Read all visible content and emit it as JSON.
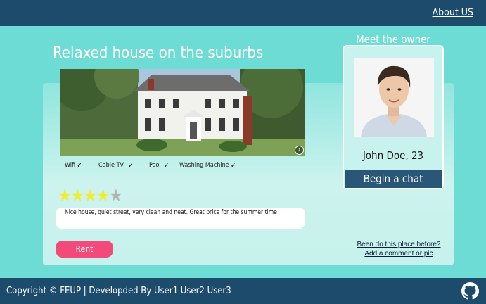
{
  "nav": {
    "about_label": "About US"
  },
  "listing": {
    "title": "Relaxed house on the suburbs",
    "amenities": [
      {
        "label": "Wifi",
        "available": true
      },
      {
        "label": "Cable TV",
        "available": true
      },
      {
        "label": "Pool",
        "available": true
      },
      {
        "label": "Washing Machine",
        "available": true
      }
    ],
    "rating": {
      "value": 4,
      "max": 5
    },
    "review": "Nice house, quiet street, very clean and neat. Great price for the summer time",
    "rent_label": "Rent",
    "links": {
      "been_before": "Been do this place before?",
      "add_comment": "Add a comment or pic"
    }
  },
  "owner": {
    "heading": "Meet the owner",
    "name": "John Doe, 23",
    "chat_label": "Begin a chat"
  },
  "footer": {
    "text": "Copyright © FEUP | Developded By User1 User2 User3"
  },
  "icons": {
    "next": "chevron-right-circle-icon",
    "check": "check-circle-icon",
    "footer": "github-icon"
  },
  "colors": {
    "header": "#1d4b6b",
    "background": "#6cdcd4",
    "rent_button": "#f24a7a",
    "chat_button": "#2a5678",
    "star": "#f4ec29"
  }
}
